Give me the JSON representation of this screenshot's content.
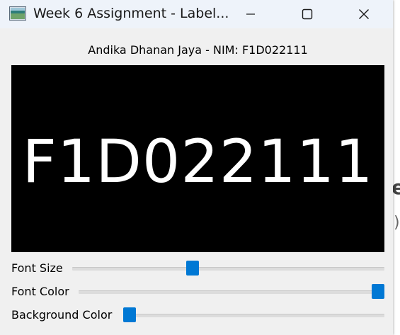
{
  "window": {
    "title": "Week 6 Assignment - Label...",
    "icon": "app-window-icon",
    "controls": {
      "minimize": "minimize-icon",
      "maximize": "maximize-icon",
      "close": "close-icon"
    }
  },
  "header": {
    "subtitle": "Andika Dhanan Jaya - NIM: F1D022111"
  },
  "display": {
    "text": "F1D022111",
    "font_color": "#ffffff",
    "background_color": "#000000"
  },
  "controls": {
    "accent": "#0078d4",
    "sliders": [
      {
        "label": "Font Size",
        "value_fraction": 0.38
      },
      {
        "label": "Font Color",
        "value_fraction": 1.0
      },
      {
        "label": "Background Color",
        "value_fraction": 0.0
      }
    ]
  },
  "background_desktop": {
    "glyph_a": "e",
    "glyph_b": ")"
  }
}
